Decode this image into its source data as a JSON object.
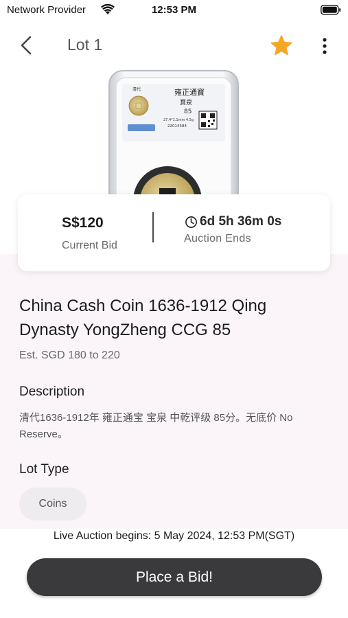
{
  "status_bar": {
    "carrier": "Network Provider",
    "time": "12:53 PM"
  },
  "header": {
    "title": "Lot 1",
    "favorite_icon": "star-icon",
    "favorite_color": "#F5A623",
    "more_icon": "more-vertical-icon"
  },
  "coin_image": {
    "label_lines": [
      "清代",
      "雍正通寶",
      "寶泉",
      "85",
      "27.4*1.1mm 4.5g",
      "22014584"
    ]
  },
  "bid_card": {
    "current_bid": "S$120",
    "current_bid_label": "Current Bid",
    "time_left": "6d 5h 36m 0s",
    "time_left_label": "Auction Ends",
    "clock_icon": "clock-icon"
  },
  "lot": {
    "title": "China Cash Coin 1636-1912 Qing Dynasty YongZheng CCG 85",
    "estimate": "Est. SGD 180 to 220",
    "description_heading": "Description",
    "description": "清代1636-1912年 雍正通宝 宝泉 中乾评级 85分。无底价 No Reserve。",
    "lot_type_heading": "Lot Type",
    "lot_type": "Coins"
  },
  "footer": {
    "live_auction_text": "Live Auction begins: 5 May 2024, 12:53 PM(SGT)",
    "place_bid_label": "Place a Bid!",
    "button_color": "#3A3A3C"
  }
}
